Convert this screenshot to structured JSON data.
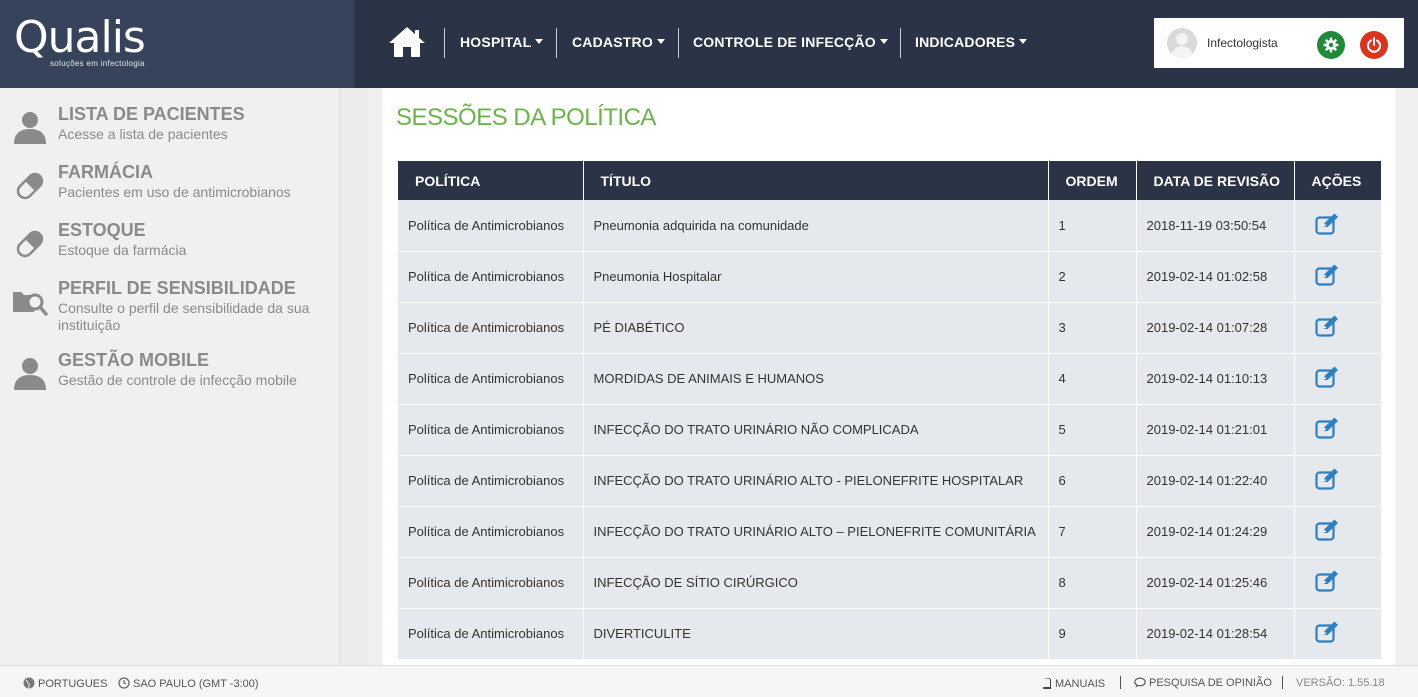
{
  "brand": {
    "name": "Qualis",
    "tagline": "soluções em infectologia"
  },
  "nav": {
    "items": [
      {
        "label": "HOSPITAL"
      },
      {
        "label": "CADASTRO"
      },
      {
        "label": "CONTROLE DE INFECÇÃO"
      },
      {
        "label": "INDICADORES"
      }
    ]
  },
  "user": {
    "name": "Infectologista"
  },
  "sidebar": {
    "items": [
      {
        "title": "LISTA DE PACIENTES",
        "desc": "Acesse a lista de pacientes",
        "icon": "user-icon"
      },
      {
        "title": "FARMÁCIA",
        "desc": "Pacientes em uso de antimicrobianos",
        "icon": "pill-icon"
      },
      {
        "title": "ESTOQUE",
        "desc": "Estoque da farmácia",
        "icon": "pill-icon"
      },
      {
        "title": "PERFIL DE SENSIBILIDADE",
        "desc": "Consulte o perfil de sensibilidade da sua instituição",
        "icon": "folder-search-icon"
      },
      {
        "title": "GESTÃO MOBILE",
        "desc": "Gestão de controle de infecção mobile",
        "icon": "user-icon"
      }
    ]
  },
  "main": {
    "title": "SESSÕES DA POLÍTICA",
    "columns": [
      "POLÍTICA",
      "TÍTULO",
      "ORDEM",
      "DATA DE REVISÃO",
      "AÇÕES"
    ],
    "rows": [
      {
        "politica": "Política de Antimicrobianos",
        "titulo": "Pneumonia adquirida na comunidade",
        "ordem": "1",
        "data": "2018-11-19 03:50:54"
      },
      {
        "politica": "Política de Antimicrobianos",
        "titulo": "Pneumonia Hospitalar",
        "ordem": "2",
        "data": "2019-02-14 01:02:58"
      },
      {
        "politica": "Política de Antimicrobianos",
        "titulo": "PÉ DIABÉTICO",
        "ordem": "3",
        "data": "2019-02-14 01:07:28"
      },
      {
        "politica": "Política de Antimicrobianos",
        "titulo": "MORDIDAS DE ANIMAIS E HUMANOS",
        "ordem": "4",
        "data": "2019-02-14 01:10:13"
      },
      {
        "politica": "Política de Antimicrobianos",
        "titulo": "INFECÇÃO DO TRATO URINÁRIO NÃO COMPLICADA",
        "ordem": "5",
        "data": "2019-02-14 01:21:01"
      },
      {
        "politica": "Política de Antimicrobianos",
        "titulo": "INFECÇÃO DO TRATO URINÁRIO ALTO - PIELONEFRITE HOSPITALAR",
        "ordem": "6",
        "data": "2019-02-14 01:22:40"
      },
      {
        "politica": "Política de Antimicrobianos",
        "titulo": "INFECÇÃO DO TRATO URINÁRIO ALTO – PIELONEFRITE COMUNITÁRIA",
        "ordem": "7",
        "data": "2019-02-14 01:24:29"
      },
      {
        "politica": "Política de Antimicrobianos",
        "titulo": "INFECÇÃO DE SÍTIO CIRÚRGICO",
        "ordem": "8",
        "data": "2019-02-14 01:25:46"
      },
      {
        "politica": "Política de Antimicrobianos",
        "titulo": "DIVERTICULITE",
        "ordem": "9",
        "data": "2019-02-14 01:28:54"
      }
    ]
  },
  "footer": {
    "language": "PORTUGUES",
    "timezone": "SAO PAULO (GMT -3:00)",
    "manuals": "MANUAIS",
    "survey": "PESQUISA DE OPINIÃO",
    "version": "VERSÃO: 1.55.18"
  },
  "colors": {
    "accent": "#6bb34a",
    "header": "#2b3446",
    "edit": "#2f7fc1"
  }
}
